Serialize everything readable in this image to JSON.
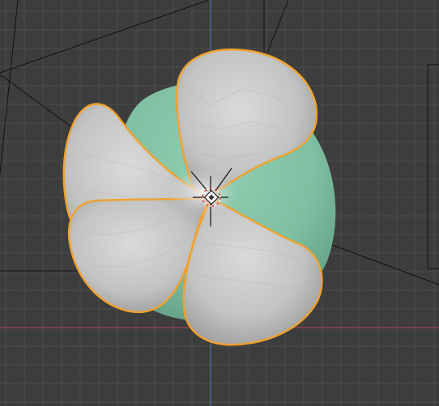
{
  "viewport": {
    "mode": "3d-viewport",
    "colors": {
      "background": "#3d3d3d",
      "grid": "#4a4a4a",
      "axis_x": "#b4434f",
      "axis_y": "#4a7cb0",
      "selection_outline": "#f0a22e",
      "petal": "#c9cac9",
      "petal_shadow": "#8f9190",
      "inner_sphere": "#7fbfa2",
      "inner_sphere_shadow": "#5f9f85",
      "origin": "#f7f7f7",
      "cursor_ring": "#e0524f"
    },
    "icons": [
      "object-origin-icon",
      "3d-cursor-icon"
    ]
  }
}
